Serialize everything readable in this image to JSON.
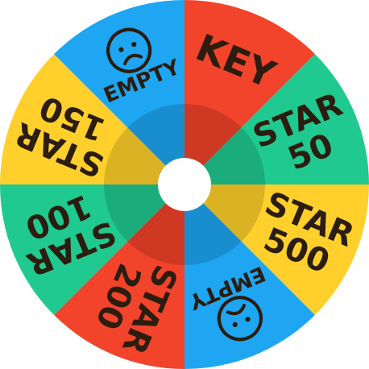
{
  "wheel": {
    "title": "",
    "colors": {
      "red": "#f2432b",
      "green": "#1fc98f",
      "yellow": "#ffd02b",
      "blue": "#1ea6f2",
      "text_dark": "#2b1d10",
      "text_light": "#ffffff",
      "hub": "#ffffff",
      "inner_shade": "rgba(0,0,0,0.14)"
    },
    "segments": [
      {
        "label_line1": "KEY",
        "label_line2": "",
        "color": "#f2432b",
        "text_color": "#ffffff",
        "icon": ""
      },
      {
        "label_line1": "STAR",
        "label_line2": "50",
        "color": "#1fc98f",
        "text_color": "#2b1d10",
        "icon": ""
      },
      {
        "label_line1": "STAR",
        "label_line2": "500",
        "color": "#ffd02b",
        "text_color": "#2b1d10",
        "icon": ""
      },
      {
        "label_line1": "EMPTY",
        "label_line2": "",
        "color": "#1ea6f2",
        "text_color": "#2b1d10",
        "icon": "sad-face-icon"
      },
      {
        "label_line1": "STAR",
        "label_line2": "200",
        "color": "#f2432b",
        "text_color": "#ffffff",
        "icon": ""
      },
      {
        "label_line1": "STAR",
        "label_line2": "100",
        "color": "#1fc98f",
        "text_color": "#2b1d10",
        "icon": ""
      },
      {
        "label_line1": "STAR",
        "label_line2": "150",
        "color": "#ffd02b",
        "text_color": "#2b1d10",
        "icon": ""
      },
      {
        "label_line1": "EMPTY",
        "label_line2": "",
        "color": "#1ea6f2",
        "text_color": "#2b1d10",
        "icon": "sad-face-icon"
      }
    ]
  }
}
